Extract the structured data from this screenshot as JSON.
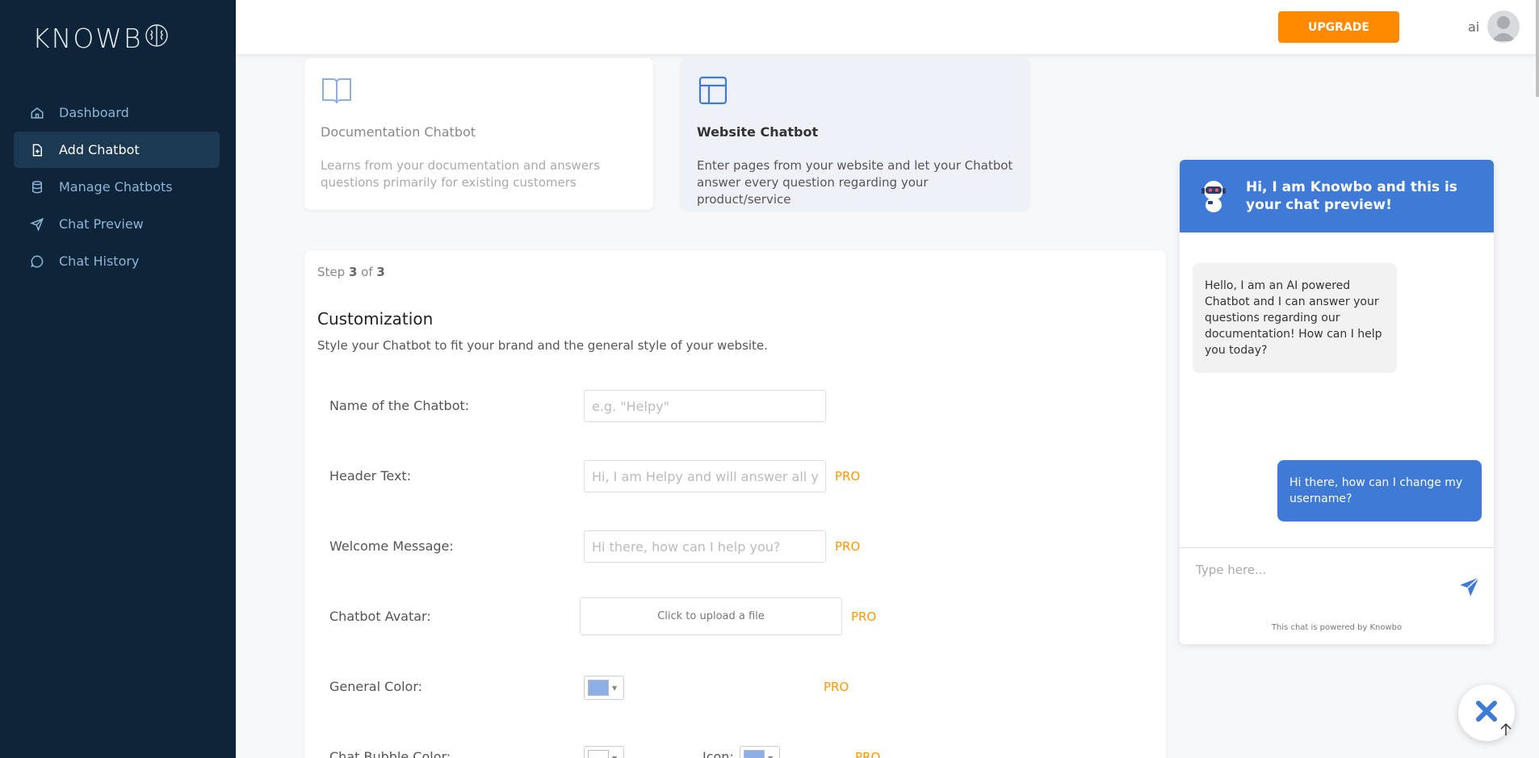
{
  "brand": {
    "logo_text": "KNOWB"
  },
  "sidebar": {
    "items": [
      {
        "label": "Dashboard",
        "icon": "home-icon"
      },
      {
        "label": "Add Chatbot",
        "icon": "add-file-icon",
        "active": true
      },
      {
        "label": "Manage Chatbots",
        "icon": "database-icon"
      },
      {
        "label": "Chat Preview",
        "icon": "send-icon"
      },
      {
        "label": "Chat History",
        "icon": "chat-bubble-icon"
      }
    ]
  },
  "topbar": {
    "upgrade_label": "UPGRADE",
    "user_initials": "ai"
  },
  "cards": [
    {
      "title": "Documentation Chatbot",
      "description": "Learns from your documentation and answers questions primarily for existing customers",
      "icon": "book-icon"
    },
    {
      "title": "Website Chatbot",
      "description": "Enter pages from your website and let your Chatbot answer every question regarding your product/service",
      "icon": "layout-icon",
      "selected": true
    }
  ],
  "form": {
    "step_prefix": "Step",
    "step_current": "3",
    "step_of": "of",
    "step_total": "3",
    "title": "Customization",
    "description": "Style your Chatbot to fit your brand and the general style of your website.",
    "name_label": "Name of the Chatbot:",
    "name_placeholder": "e.g. \"Helpy\"",
    "header_label": "Header Text:",
    "header_placeholder": "Hi, I am Helpy and will answer all your",
    "welcome_label": "Welcome Message:",
    "welcome_placeholder": "Hi there, how can I help you?",
    "avatar_label": "Chatbot Avatar:",
    "upload_text": "Click to upload a file",
    "general_color_label": "General Color:",
    "bubble_color_label": "Chat Bubble Color:",
    "icon_label": "Icon:",
    "pro_label": "PRO",
    "general_color": "#8eaee6",
    "bubble_color": "#ffffff",
    "icon_color": "#8eaee6"
  },
  "chat": {
    "header_text": "Hi, I am Knowbo and this is your chat preview!",
    "bot_message": "Hello, I am an AI powered Chatbot and I can answer your questions regarding our documentation! How can I help you today?",
    "user_message": "Hi there, how can I change my username?",
    "input_placeholder": "Type here...",
    "powered_by": "This chat is powered by Knowbo",
    "accent_color": "#3f7bd6"
  },
  "colors": {
    "sidebar_bg": "#0e2438",
    "upgrade": "#ff8a00",
    "pro": "#ff9800"
  }
}
